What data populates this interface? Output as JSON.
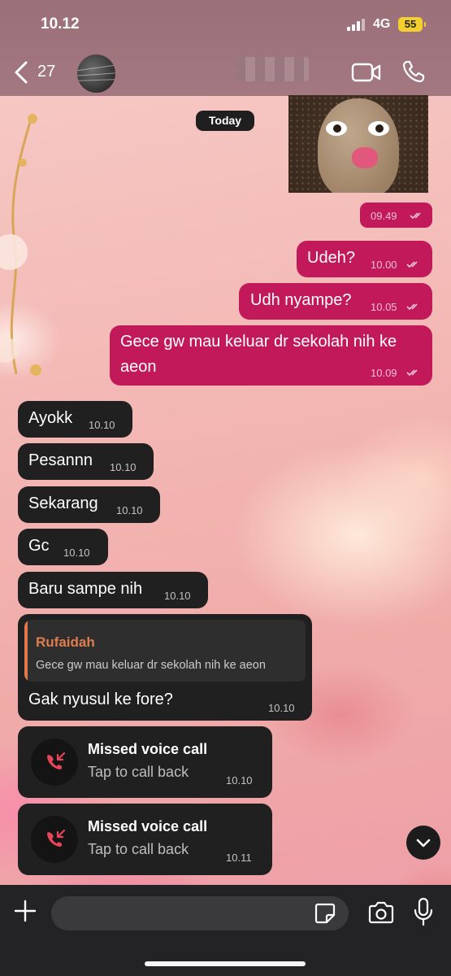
{
  "status_bar": {
    "time": "10.12",
    "network": "4G",
    "battery": "55"
  },
  "header": {
    "unread_count": "27",
    "contact_name": "",
    "icons": {
      "back": "chevron-left-icon",
      "video": "video-camera-icon",
      "call": "phone-icon"
    }
  },
  "chat": {
    "date_label": "Today",
    "sticker": {
      "time": "09.49"
    },
    "outgoing": [
      {
        "text": "Udeh?",
        "time": "10.00"
      },
      {
        "text": "Udh nyampe?",
        "time": "10.05"
      },
      {
        "text_line1": "Gece gw mau keluar dr sekolah nih ke",
        "text_line2": "aeon",
        "time": "10.09"
      }
    ],
    "incoming": [
      {
        "text": "Ayokk",
        "time": "10.10"
      },
      {
        "text": "Pesannn",
        "time": "10.10"
      },
      {
        "text": "Sekarang",
        "time": "10.10"
      },
      {
        "text": "Gc",
        "time": "10.10"
      },
      {
        "text": "Baru sampe nih",
        "time": "10.10"
      }
    ],
    "reply_message": {
      "quoted_name": "Rufaidah",
      "quoted_text": "Gece gw mau keluar dr sekolah nih ke aeon",
      "text": "Gak nyusul ke fore?",
      "time": "10.10"
    },
    "missed_calls": [
      {
        "title": "Missed voice call",
        "subtitle": "Tap to call back",
        "time": "10.10"
      },
      {
        "title": "Missed voice call",
        "subtitle": "Tap to call back",
        "time": "10.11"
      }
    ]
  },
  "composer": {
    "placeholder": "",
    "icons": [
      "plus-icon",
      "sticker-icon",
      "camera-icon",
      "microphone-icon"
    ]
  },
  "colors": {
    "outgoing_bubble": "#c2195a",
    "incoming_bubble": "#202020",
    "reply_accent": "#e07d4f",
    "missed_call_red": "#e8455a"
  }
}
